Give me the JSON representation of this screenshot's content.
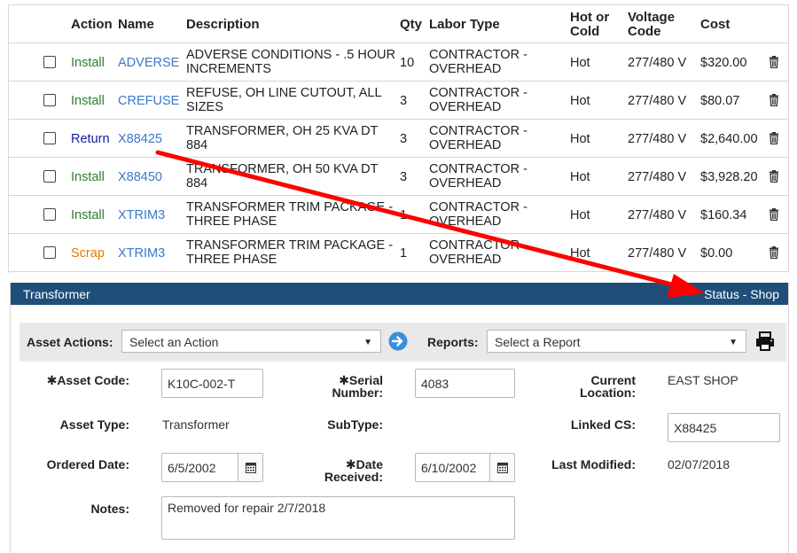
{
  "table": {
    "headers": {
      "action": "Action",
      "name": "Name",
      "description": "Description",
      "qty": "Qty",
      "labor_type": "Labor Type",
      "hot_or_cold_1": "Hot or",
      "hot_or_cold_2": "Cold",
      "voltage_code_1": "Voltage",
      "voltage_code_2": "Code",
      "cost": "Cost"
    },
    "rows": [
      {
        "action": "Install",
        "name": "ADVERSE",
        "desc1": "ADVERSE CONDITIONS - .5 HOUR",
        "desc2": "INCREMENTS",
        "qty": "10",
        "labor1": "CONTRACTOR -",
        "labor2": "OVERHEAD",
        "hot": "Hot",
        "voltage": "277/480 V",
        "cost": "$320.00"
      },
      {
        "action": "Install",
        "name": "CREFUSE",
        "desc1": "REFUSE, OH LINE CUTOUT, ALL",
        "desc2": "SIZES",
        "qty": "3",
        "labor1": "CONTRACTOR -",
        "labor2": "OVERHEAD",
        "hot": "Hot",
        "voltage": "277/480 V",
        "cost": "$80.07"
      },
      {
        "action": "Return",
        "name": "X88425",
        "desc1": "TRANSFORMER, OH 25 KVA DT",
        "desc2": "884",
        "qty": "3",
        "labor1": "CONTRACTOR -",
        "labor2": "OVERHEAD",
        "hot": "Hot",
        "voltage": "277/480 V",
        "cost": "$2,640.00"
      },
      {
        "action": "Install",
        "name": "X88450",
        "desc1": "TRANSFORMER, OH 50 KVA DT",
        "desc2": "884",
        "qty": "3",
        "labor1": "CONTRACTOR -",
        "labor2": "OVERHEAD",
        "hot": "Hot",
        "voltage": "277/480 V",
        "cost": "$3,928.20"
      },
      {
        "action": "Install",
        "name": "XTRIM3",
        "desc1": "TRANSFORMER TRIM PACKAGE -",
        "desc2": "THREE PHASE",
        "qty": "1",
        "labor1": "CONTRACTOR -",
        "labor2": "OVERHEAD",
        "hot": "Hot",
        "voltage": "277/480 V",
        "cost": "$160.34"
      },
      {
        "action": "Scrap",
        "name": "XTRIM3",
        "desc1": "TRANSFORMER TRIM PACKAGE -",
        "desc2": "THREE PHASE",
        "qty": "1",
        "labor1": "CONTRACTOR -",
        "labor2": "OVERHEAD",
        "hot": "Hot",
        "voltage": "277/480 V",
        "cost": "$0.00"
      }
    ]
  },
  "panel": {
    "title": "Transformer",
    "status": "Status - Shop"
  },
  "actions_bar": {
    "asset_actions_label": "Asset Actions:",
    "asset_actions_selected": "Select an Action",
    "reports_label": "Reports:",
    "reports_selected": "Select a Report"
  },
  "form": {
    "asset_code_label": "Asset Code:",
    "asset_code_value": "K10C-002-T",
    "serial_label_1": "Serial",
    "serial_label_2": "Number:",
    "serial_value": "4083",
    "current_location_label_1": "Current",
    "current_location_label_2": "Location:",
    "current_location_value": "EAST SHOP",
    "asset_type_label": "Asset Type:",
    "asset_type_value": "Transformer",
    "subtype_label": "SubType:",
    "linked_cs_label": "Linked CS:",
    "linked_cs_value": "X88425",
    "ordered_date_label": "Ordered Date:",
    "ordered_date_value": "6/5/2002",
    "date_received_label_1": "Date",
    "date_received_label_2": "Received:",
    "date_received_value": "6/10/2002",
    "last_modified_label": "Last Modified:",
    "last_modified_value": "02/07/2018",
    "notes_label": "Notes:",
    "notes_value": "Removed for repair 2/7/2018",
    "required_mark": "✱"
  },
  "colors": {
    "header_bg": "#1f4e79",
    "install": "#2e7d32",
    "return": "#1a1aa6",
    "scrap": "#e07b00",
    "link": "#3a78c9",
    "arrow": "#ff0000"
  },
  "icons": {
    "row_delete": "trash-icon",
    "go": "arrow-circle-right-icon",
    "print": "printer-icon",
    "calendar": "calendar-icon",
    "dropdown": "caret-down-icon"
  }
}
